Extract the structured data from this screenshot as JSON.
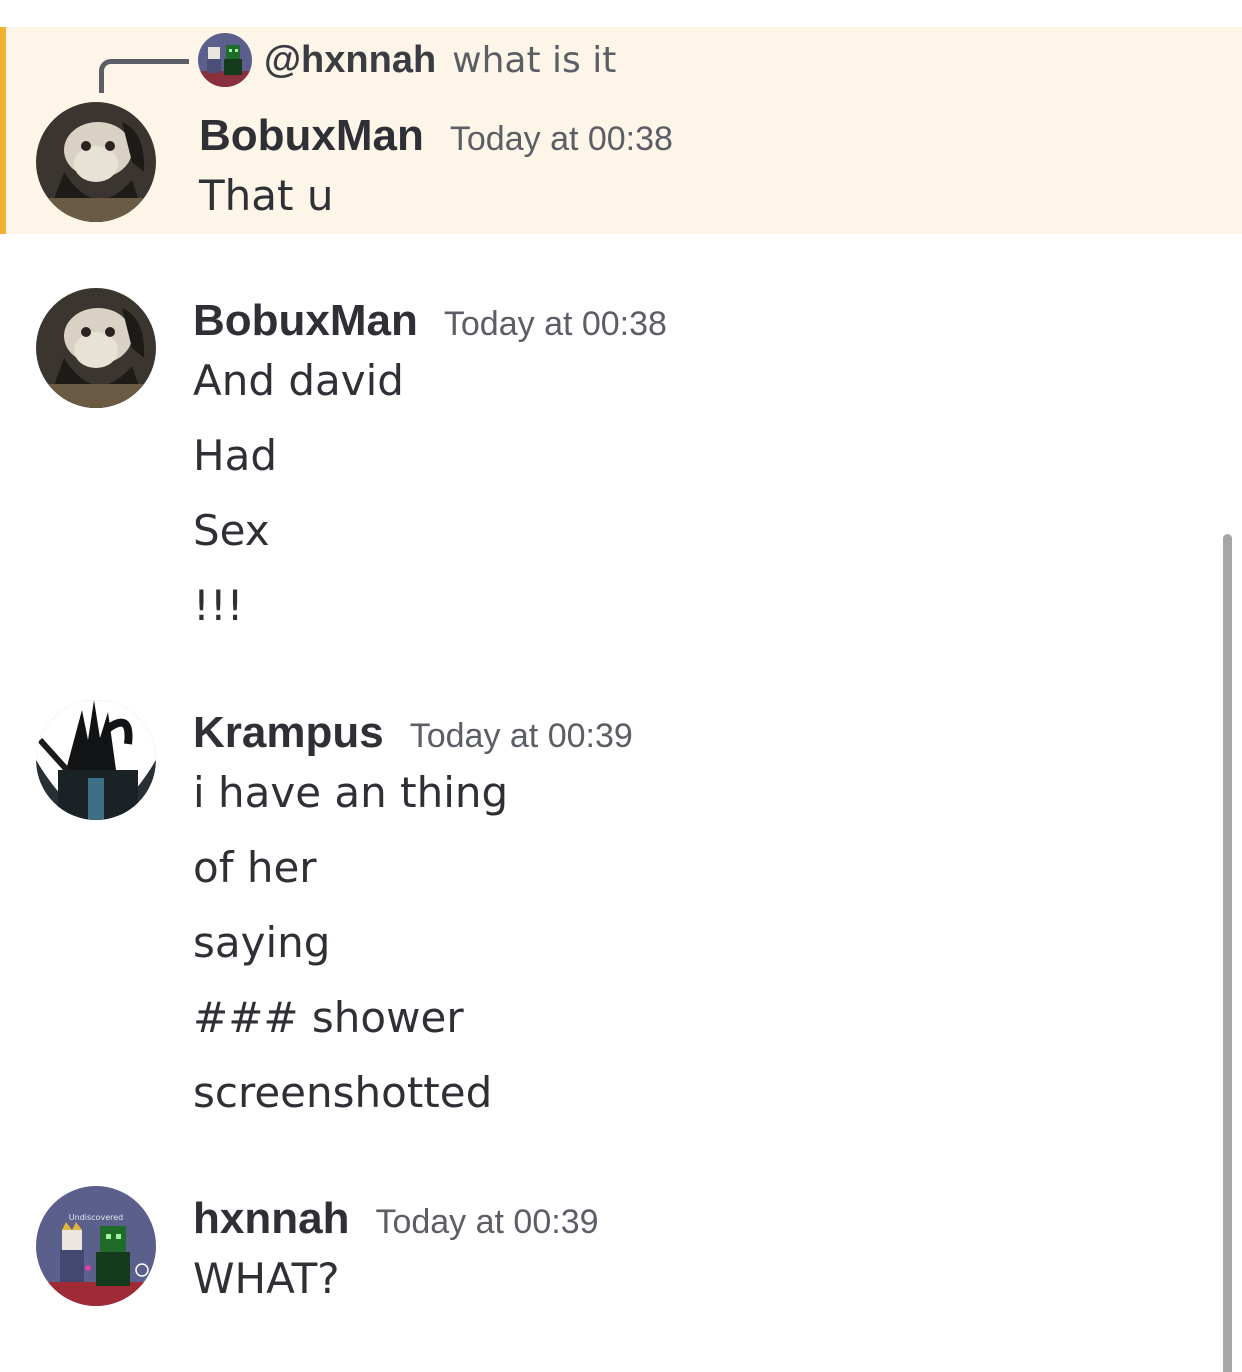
{
  "reply": {
    "username": "@hxnnah",
    "text": "what is it",
    "avatar_icon": "user-avatar-roblox"
  },
  "messages": [
    {
      "author": "BobuxMan",
      "timestamp": "Today at 00:38",
      "lines": [
        "That u"
      ],
      "avatar_icon": "user-avatar-cat",
      "highlighted": true
    },
    {
      "author": "BobuxMan",
      "timestamp": "Today at 00:38",
      "lines": [
        "And david",
        "Had",
        "Sex",
        "!!!"
      ],
      "avatar_icon": "user-avatar-cat"
    },
    {
      "author": "Krampus",
      "timestamp": "Today at 00:39",
      "lines": [
        "i have an thing",
        "of her",
        "saying",
        "### shower",
        "screenshotted"
      ],
      "avatar_icon": "user-avatar-krampus"
    },
    {
      "author": "hxnnah",
      "timestamp": "Today at 00:39",
      "lines": [
        "WHAT?"
      ],
      "avatar_icon": "user-avatar-roblox",
      "avatar_caption": "Undiscovered"
    }
  ],
  "colors": {
    "highlight_bg": "#fdf5e8",
    "highlight_bar": "#f0b132",
    "author": "#2e3035",
    "timestamp": "#5c5e66"
  }
}
